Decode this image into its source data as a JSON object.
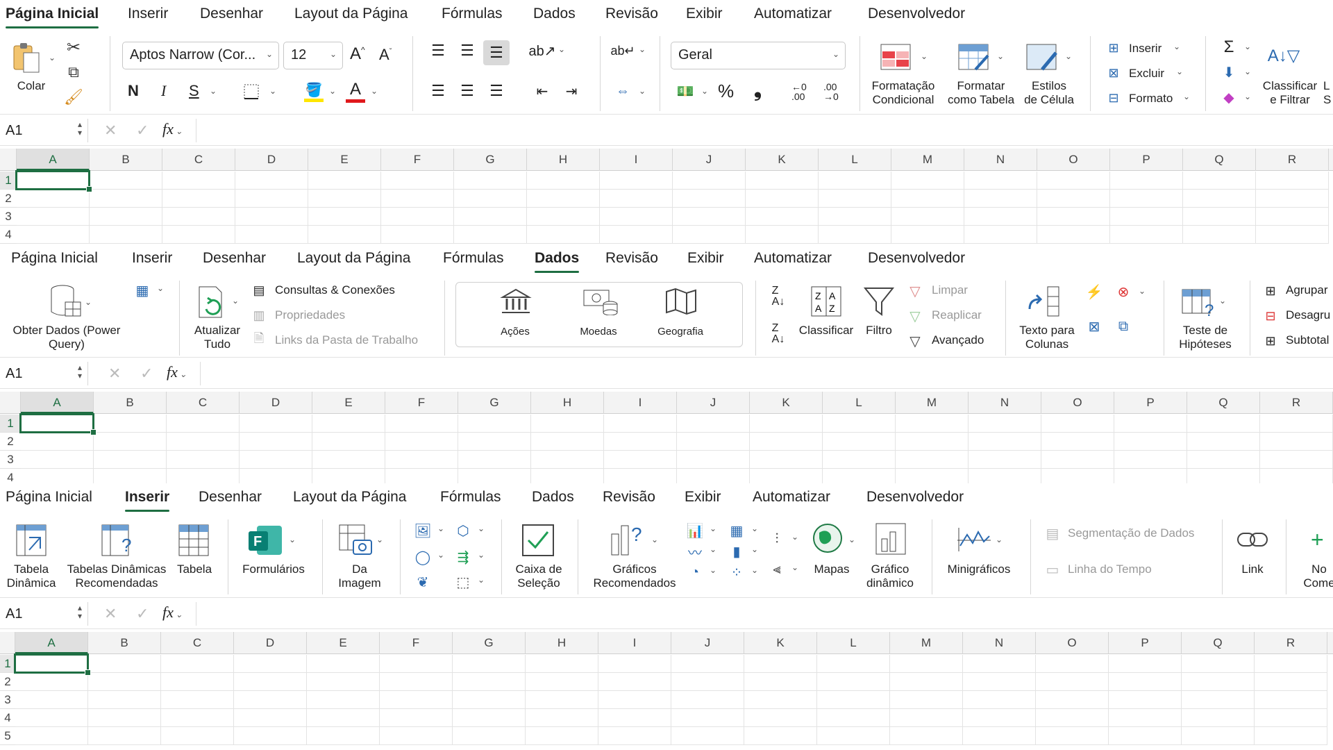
{
  "panels": [
    {
      "tabs": [
        "Página Inicial",
        "Inserir",
        "Desenhar",
        "Layout da Página",
        "Fórmulas",
        "Dados",
        "Revisão",
        "Exibir",
        "Automatizar",
        "Desenvolvedor"
      ],
      "active_tab": "Página Inicial",
      "clipboard": {
        "paste_label": "Colar"
      },
      "font": {
        "name": "Aptos Narrow (Cor...",
        "size": "12",
        "bold": "N",
        "italic": "I",
        "underline": "S"
      },
      "number": {
        "format": "Geral",
        "percent": "%"
      },
      "styles": {
        "conditional": "Formatação\nCondicional",
        "table": "Formatar\ncomo Tabela",
        "cell": "Estilos\nde Célula"
      },
      "cells": {
        "insert": "Inserir",
        "delete": "Excluir",
        "format": "Formato"
      },
      "editing": {
        "sort": "Classificar\ne Filtrar",
        "cut_label": "L\nS"
      },
      "name_box": "A1",
      "rows": [
        "1",
        "2",
        "3",
        "4"
      ]
    },
    {
      "tabs": [
        "Página Inicial",
        "Inserir",
        "Desenhar",
        "Layout da Página",
        "Fórmulas",
        "Dados",
        "Revisão",
        "Exibir",
        "Automatizar",
        "Desenvolvedor"
      ],
      "active_tab": "Dados",
      "get_data": "Obter Dados (Power\nQuery)",
      "refresh": "Atualizar\nTudo",
      "queries": "Consultas & Conexões",
      "properties": "Propriedades",
      "links": "Links da Pasta de Trabalho",
      "datatypes": [
        "Ações",
        "Moedas",
        "Geografia"
      ],
      "sort": "Classificar",
      "filter": "Filtro",
      "clear": "Limpar",
      "reapply": "Reaplicar",
      "advanced": "Avançado",
      "text_to_columns": "Texto para\nColunas",
      "what_if": "Teste de\nHipóteses",
      "group": "Agrupar",
      "ungroup": "Desagru",
      "subtotal": "Subtotal",
      "name_box": "A1",
      "rows": [
        "1",
        "2",
        "3",
        "4"
      ]
    },
    {
      "tabs": [
        "Página Inicial",
        "Inserir",
        "Desenhar",
        "Layout da Página",
        "Fórmulas",
        "Dados",
        "Revisão",
        "Exibir",
        "Automatizar",
        "Desenvolvedor"
      ],
      "active_tab": "Inserir",
      "pivot": "Tabela\nDinâmica",
      "rec_pivot": "Tabelas Dinâmicas\nRecomendadas",
      "table": "Tabela",
      "forms": "Formulários",
      "from_image": "Da\nImagem",
      "checkbox": "Caixa de\nSeleção",
      "rec_charts": "Gráficos\nRecomendados",
      "maps": "Mapas",
      "pivot_chart": "Gráfico\ndinâmico",
      "sparklines": "Minigráficos",
      "slicer": "Segmentação de Dados",
      "timeline": "Linha do Tempo",
      "link": "Link",
      "new_comment": "No\nCome",
      "name_box": "A1",
      "rows": [
        "1",
        "2",
        "3",
        "4",
        "5"
      ]
    }
  ],
  "columns": [
    "A",
    "B",
    "C",
    "D",
    "E",
    "F",
    "G",
    "H",
    "I",
    "J",
    "K",
    "L",
    "M",
    "N",
    "O",
    "P",
    "Q",
    "R"
  ],
  "fx": "fx",
  "colors": {
    "accent": "#1e6e42",
    "fill_yellow": "#ffe600",
    "font_red": "#e0191c"
  }
}
